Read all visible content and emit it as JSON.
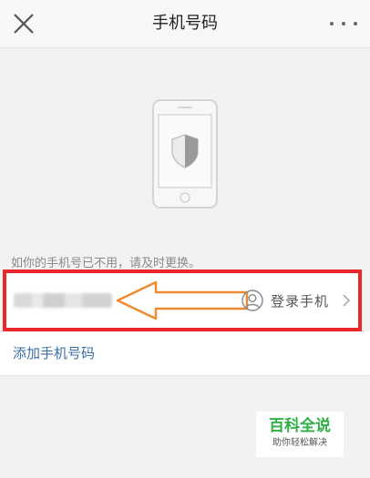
{
  "header": {
    "title": "手机号码"
  },
  "hint_text": "如你的手机号已不用，请及时更换。",
  "phone_entry": {
    "number_masked": "",
    "login_label": "登录手机"
  },
  "add_phone_label": "添加手机号码",
  "watermark": {
    "title": "百科全说",
    "subtitle": "助你轻松解决"
  },
  "icons": {
    "close": "close-icon",
    "more": "more-icon",
    "phone_shield": "phone-shield-icon",
    "user": "user-icon",
    "chevron": "chevron-right-icon"
  },
  "colors": {
    "highlight": "#e8262b",
    "arrow": "#f08a30",
    "link": "#3a6ea5",
    "watermark": "#2fae45"
  }
}
